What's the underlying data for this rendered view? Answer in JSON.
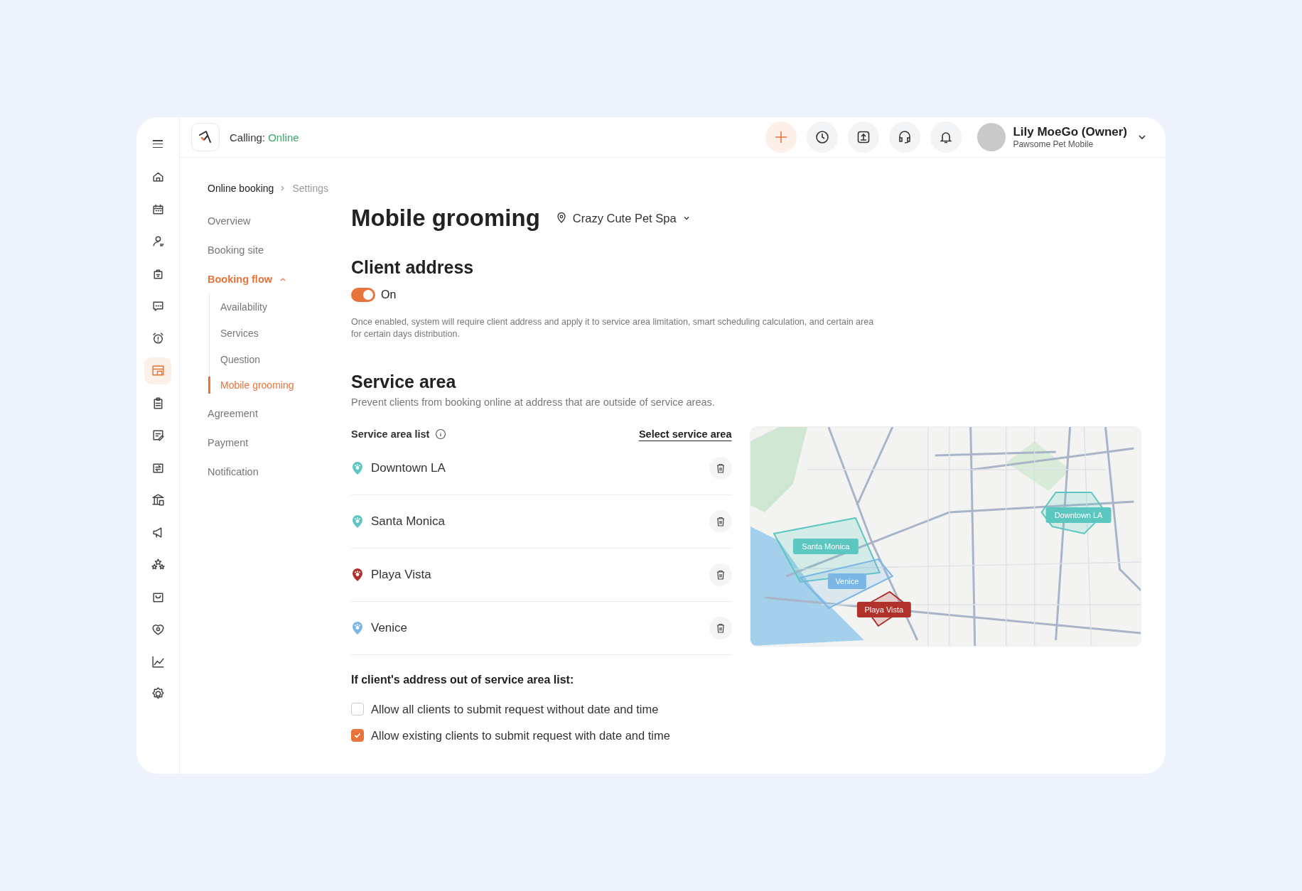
{
  "sidebar": {
    "items": [
      {
        "selected": false
      },
      {
        "selected": false
      },
      {
        "selected": false
      },
      {
        "selected": false
      },
      {
        "selected": false
      },
      {
        "selected": false
      },
      {
        "selected": true
      },
      {
        "selected": false
      },
      {
        "selected": false
      },
      {
        "selected": false
      },
      {
        "selected": false
      },
      {
        "selected": false
      },
      {
        "selected": false
      },
      {
        "selected": false
      },
      {
        "selected": false
      },
      {
        "selected": false
      },
      {
        "selected": false
      }
    ]
  },
  "topbar": {
    "calling_label": "Calling:",
    "calling_status": "Online",
    "user_name": "Lily MoeGo (Owner)",
    "business": "Pawsome Pet Mobile"
  },
  "breadcrumb": [
    "Online booking",
    "Settings"
  ],
  "nav": {
    "items": [
      {
        "label": "Overview",
        "selected": false
      },
      {
        "label": "Booking site",
        "selected": false
      },
      {
        "label": "Booking flow",
        "expanded": true,
        "children": [
          {
            "label": "Availability",
            "selected": false
          },
          {
            "label": "Services",
            "selected": false
          },
          {
            "label": "Question",
            "selected": false
          },
          {
            "label": "Mobile grooming",
            "selected": true
          }
        ]
      },
      {
        "label": "Agreement",
        "selected": false
      },
      {
        "label": "Payment",
        "selected": false
      },
      {
        "label": "Notification",
        "selected": false
      }
    ]
  },
  "page": {
    "title": "Mobile grooming",
    "location": "Crazy Cute Pet Spa"
  },
  "client_address": {
    "heading": "Client address",
    "toggle": {
      "on": true,
      "label": "On"
    },
    "description": "Once enabled, system will require client address and apply it to service area limitation, smart scheduling calculation, and certain area for certain days distribution."
  },
  "service_area": {
    "heading": "Service area",
    "description": "Prevent clients from booking online at address that are outside of service areas.",
    "list_label": "Service area list",
    "select_link": "Select service area",
    "areas": [
      {
        "name": "Downtown LA",
        "color": "#5cc6c0"
      },
      {
        "name": "Santa Monica",
        "color": "#5cc6c0"
      },
      {
        "name": "Playa Vista",
        "color": "#b0302c"
      },
      {
        "name": "Venice",
        "color": "#7ab6e6"
      }
    ],
    "map": {
      "labels": [
        {
          "name": "Downtown LA",
          "color": "#5cc6c0"
        },
        {
          "name": "Santa Monica",
          "color": "#5cc6c0"
        },
        {
          "name": "Playa Vista",
          "color": "#b0302c"
        },
        {
          "name": "Venice",
          "color": "#7ab6e6"
        }
      ]
    }
  },
  "fallback": {
    "heading": "If client's address out of service area list:",
    "options": [
      {
        "label": "Allow all clients to submit request without date and time",
        "checked": false
      },
      {
        "label": "Allow existing clients to submit request with date and time",
        "checked": true
      }
    ]
  }
}
